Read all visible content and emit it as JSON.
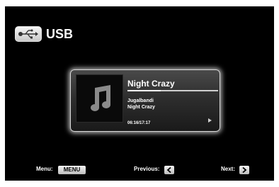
{
  "header": {
    "title": "USB",
    "icon": "usb-icon"
  },
  "now_playing": {
    "track_title": "Night Crazy",
    "artist": "Jugalbandi",
    "album": "Night Crazy",
    "time": "06:16/17:17",
    "progress": 0.37,
    "album_art_icon": "music-note-icon"
  },
  "footer": {
    "menu_label": "Menu:",
    "menu_key": "MENU",
    "previous_label": "Previous:",
    "next_label": "Next:"
  }
}
